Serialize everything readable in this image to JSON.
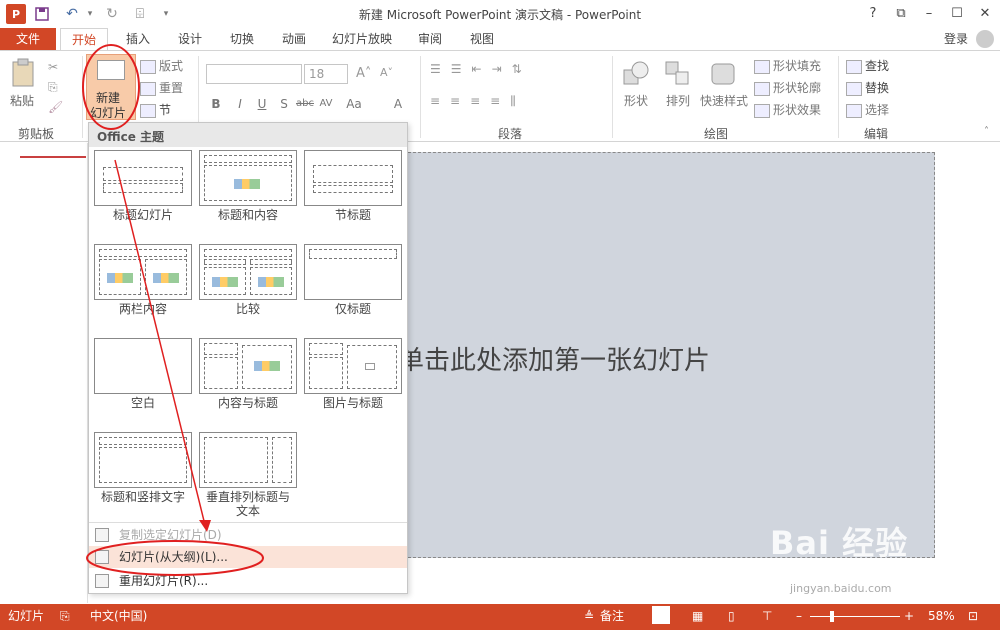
{
  "window": {
    "title": "新建 Microsoft PowerPoint 演示文稿 - PowerPoint",
    "app_letter": "P"
  },
  "tabs": [
    "文件",
    "开始",
    "插入",
    "设计",
    "切换",
    "动画",
    "幻灯片放映",
    "审阅",
    "视图"
  ],
  "signin": "登录",
  "ribbon": {
    "clipboard": {
      "paste": "粘贴",
      "label": "剪贴板"
    },
    "slides": {
      "new_slide_line1": "新建",
      "new_slide_line2": "幻灯片",
      "layout": "版式",
      "reset": "重置",
      "section": "节"
    },
    "font": {
      "size": "18"
    },
    "paragraph": {
      "label": "段落"
    },
    "drawing": {
      "shape": "形状",
      "arrange": "排列",
      "quick_styles": "快速样式",
      "fill": "形状填充",
      "outline": "形状轮廓",
      "effects": "形状效果",
      "label": "绘图"
    },
    "editing": {
      "find": "查找",
      "replace": "替换",
      "select": "选择",
      "label": "编辑"
    }
  },
  "dropdown": {
    "header": "Office 主题",
    "layouts": [
      "标题幻灯片",
      "标题和内容",
      "节标题",
      "两栏内容",
      "比较",
      "仅标题",
      "空白",
      "内容与标题",
      "图片与标题",
      "标题和竖排文字",
      "垂直排列标题与\n文本"
    ],
    "items": [
      "复制选定幻灯片(D)",
      "幻灯片(从大纲)(L)...",
      "重用幻灯片(R)..."
    ]
  },
  "slide": {
    "placeholder": "单击此处添加第一张幻灯片"
  },
  "status": {
    "slides": "幻灯片",
    "language": "中文(中国)",
    "notes": "备注",
    "zoom": "58%"
  },
  "watermark": {
    "main": "Bai 经验",
    "sub": "jingyan.baidu.com"
  },
  "colors": {
    "accent": "#d24726",
    "annotation": "#e02020"
  }
}
